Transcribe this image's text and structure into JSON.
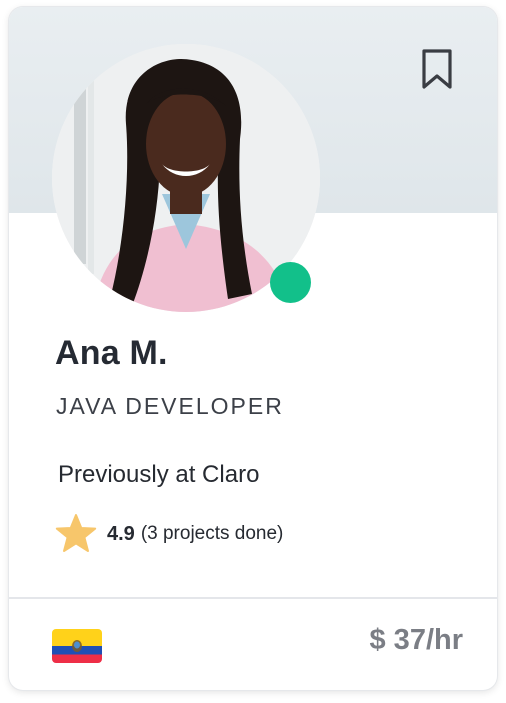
{
  "profile": {
    "name": "Ana M.",
    "role": "JAVA DEVELOPER",
    "previous_employer": "Previously at Claro",
    "rating": "4.9",
    "projects_done": "(3 projects done)",
    "hourly_rate": "$ 37/hr",
    "online": true,
    "country_flag": "ecuador-flag"
  },
  "colors": {
    "status_online": "#12c08a",
    "star": "#f7c66b",
    "banner": "#e6ecef",
    "text_dark": "#252a33",
    "text_muted": "#7b7e85"
  },
  "icons": {
    "bookmark": "bookmark-icon",
    "rating": "star-icon"
  }
}
